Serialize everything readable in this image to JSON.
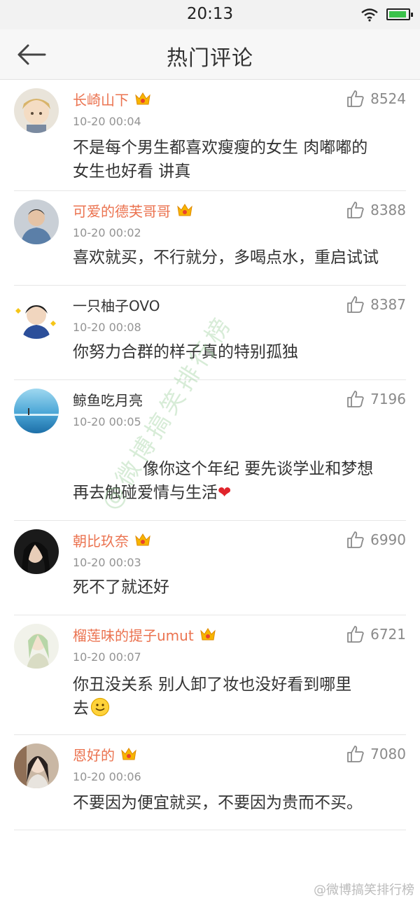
{
  "status_bar": {
    "time": "20:13"
  },
  "nav": {
    "title": "热门评论"
  },
  "comments": [
    {
      "username": "长崎山下",
      "vip": true,
      "time": "10-20 00:04",
      "likes": "8524",
      "lines": [
        "不是每个男生都喜欢瘦瘦的女生 肉嘟嘟的",
        "女生也好看 讲真"
      ]
    },
    {
      "username": "可爱的德芙哥哥",
      "vip": true,
      "time": "10-20 00:02",
      "likes": "8388",
      "lines": [
        "喜欢就买，不行就分，多喝点水，重启试试"
      ]
    },
    {
      "username": "一只柚子OVO",
      "vip": false,
      "time": "10-20 00:08",
      "likes": "8387",
      "lines": [
        "你努力合群的样子真的特别孤独"
      ]
    },
    {
      "username": "鲸鱼吃月亮",
      "vip": false,
      "time": "10-20 00:05",
      "likes": "7196",
      "lines": [
        "像你这个年纪 要先谈学业和梦想",
        "再去触碰爱情与生活"
      ],
      "emoji": "❤"
    },
    {
      "username": "朝比玖奈",
      "vip": true,
      "time": "10-20 00:03",
      "likes": "6990",
      "lines": [
        "死不了就还好"
      ]
    },
    {
      "username": "榴莲味的提子umut",
      "vip": true,
      "time": "10-20 00:07",
      "likes": "6721",
      "lines": [
        "你丑没关系 别人卸了妆也没好看到哪里",
        "去"
      ]
    },
    {
      "username": "恩好的",
      "vip": true,
      "time": "10-20 00:06",
      "likes": "7080",
      "lines": [
        "不要因为便宜就买，不要因为贵而不买。"
      ]
    }
  ],
  "watermark": {
    "diagonal": "@微博搞笑排行榜",
    "corner": "@微博搞笑排行榜"
  },
  "colors": {
    "username": "#eb7350",
    "text": "#333333",
    "meta": "#939393",
    "divider": "#e6e6e6"
  }
}
